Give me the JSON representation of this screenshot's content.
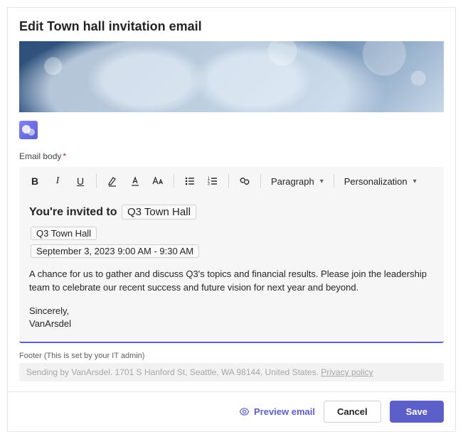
{
  "title": "Edit Town hall invitation email",
  "field_labels": {
    "email_body": "Email body"
  },
  "toolbar": {
    "paragraph_label": "Paragraph",
    "personalization_label": "Personalization"
  },
  "editor": {
    "invite_prefix": "You're invited to",
    "event_title": "Q3 Town Hall",
    "event_tag": "Q3 Town Hall",
    "event_time": "September 3, 2023 9:00 AM - 9:30 AM",
    "body_text": "A chance for us to gather and discuss Q3's topics and financial results. Please join the leadership team to celebrate our recent success and future vision for next year and beyond.",
    "signoff": "Sincerely,",
    "sender": "VanArsdel"
  },
  "footer": {
    "label": "Footer (This is set by your IT admin)",
    "text": "Sending by VanArsdel. 1701 S Hanford St, Seattle, WA 98144, United States. ",
    "privacy": "Privacy policy"
  },
  "actions": {
    "preview": "Preview email",
    "cancel": "Cancel",
    "save": "Save"
  }
}
